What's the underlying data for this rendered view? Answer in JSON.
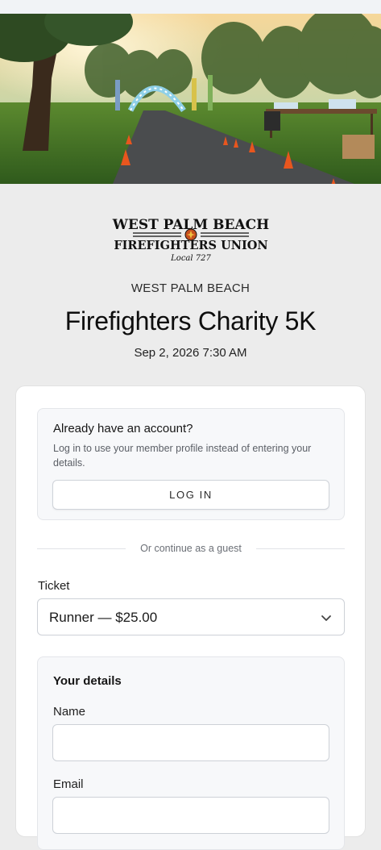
{
  "hero": {
    "image_alt": "park path with cones and balloon arch at sunrise"
  },
  "logo": {
    "line1": "WEST PALM BEACH",
    "line2": "FIREFIGHTERS UNION",
    "line3": "Local 727"
  },
  "event": {
    "venue": "WEST PALM BEACH",
    "title": "Firefighters Charity 5K",
    "datetime": "Sep 2, 2026 7:30 AM"
  },
  "login": {
    "title": "Already have an account?",
    "description": "Log in to use your member profile instead of entering your details.",
    "button_label": "LOG IN"
  },
  "divider": {
    "text": "Or continue as a guest"
  },
  "ticket": {
    "label": "Ticket",
    "selected": "Runner — $25.00",
    "icon": "chevron-down-icon"
  },
  "details": {
    "title": "Your details",
    "name_label": "Name",
    "name_value": "",
    "email_label": "Email",
    "email_value": ""
  },
  "colors": {
    "page_bg": "#ececec",
    "card_bg": "#ffffff",
    "panel_bg": "#f7f8fa",
    "text_primary": "#0e0e0e",
    "text_muted": "#5b5f66"
  }
}
